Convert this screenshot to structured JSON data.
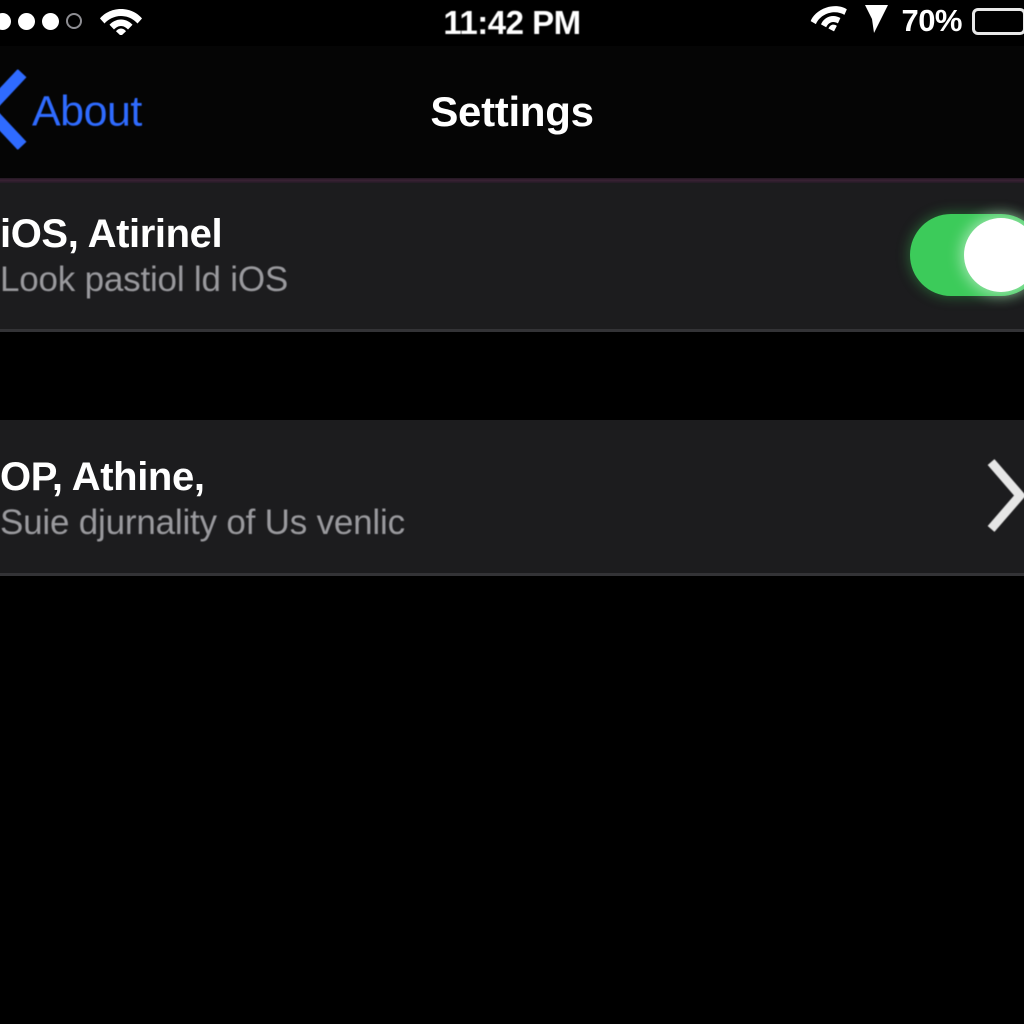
{
  "status_bar": {
    "signal_label": "signal-strength",
    "signal_dots_filled": 3,
    "signal_dots_total": 4,
    "wifi_icon": "wifi-icon",
    "time": "11:42 PM",
    "secondary_wifi_icon": "wifi-icon",
    "location_icon": "location-arrow-icon",
    "battery_percent": "70%",
    "battery_level": 70,
    "battery_color": "#4cd964"
  },
  "nav_bar": {
    "back_icon": "chevron-left-icon",
    "back_label": "About",
    "back_color": "#2f6bff",
    "title": "Settings"
  },
  "list": {
    "rows": [
      {
        "title": "iOS, Atirinel",
        "subtitle": "Look pastiol ld iOS",
        "accessory": "toggle",
        "toggle_on": true,
        "toggle_color": "#3ccb5a"
      },
      {
        "title": "OP, Athine,",
        "subtitle": "Suie djurnality of Us venlic",
        "accessory": "chevron",
        "chevron_icon": "chevron-right-icon"
      }
    ]
  },
  "colors": {
    "background": "#000000",
    "row_background": "#1c1c1e",
    "primary_text": "#ffffff",
    "secondary_text": "#9a9a9e",
    "accent_blue": "#2f6bff",
    "accent_green": "#3ccb5a"
  }
}
